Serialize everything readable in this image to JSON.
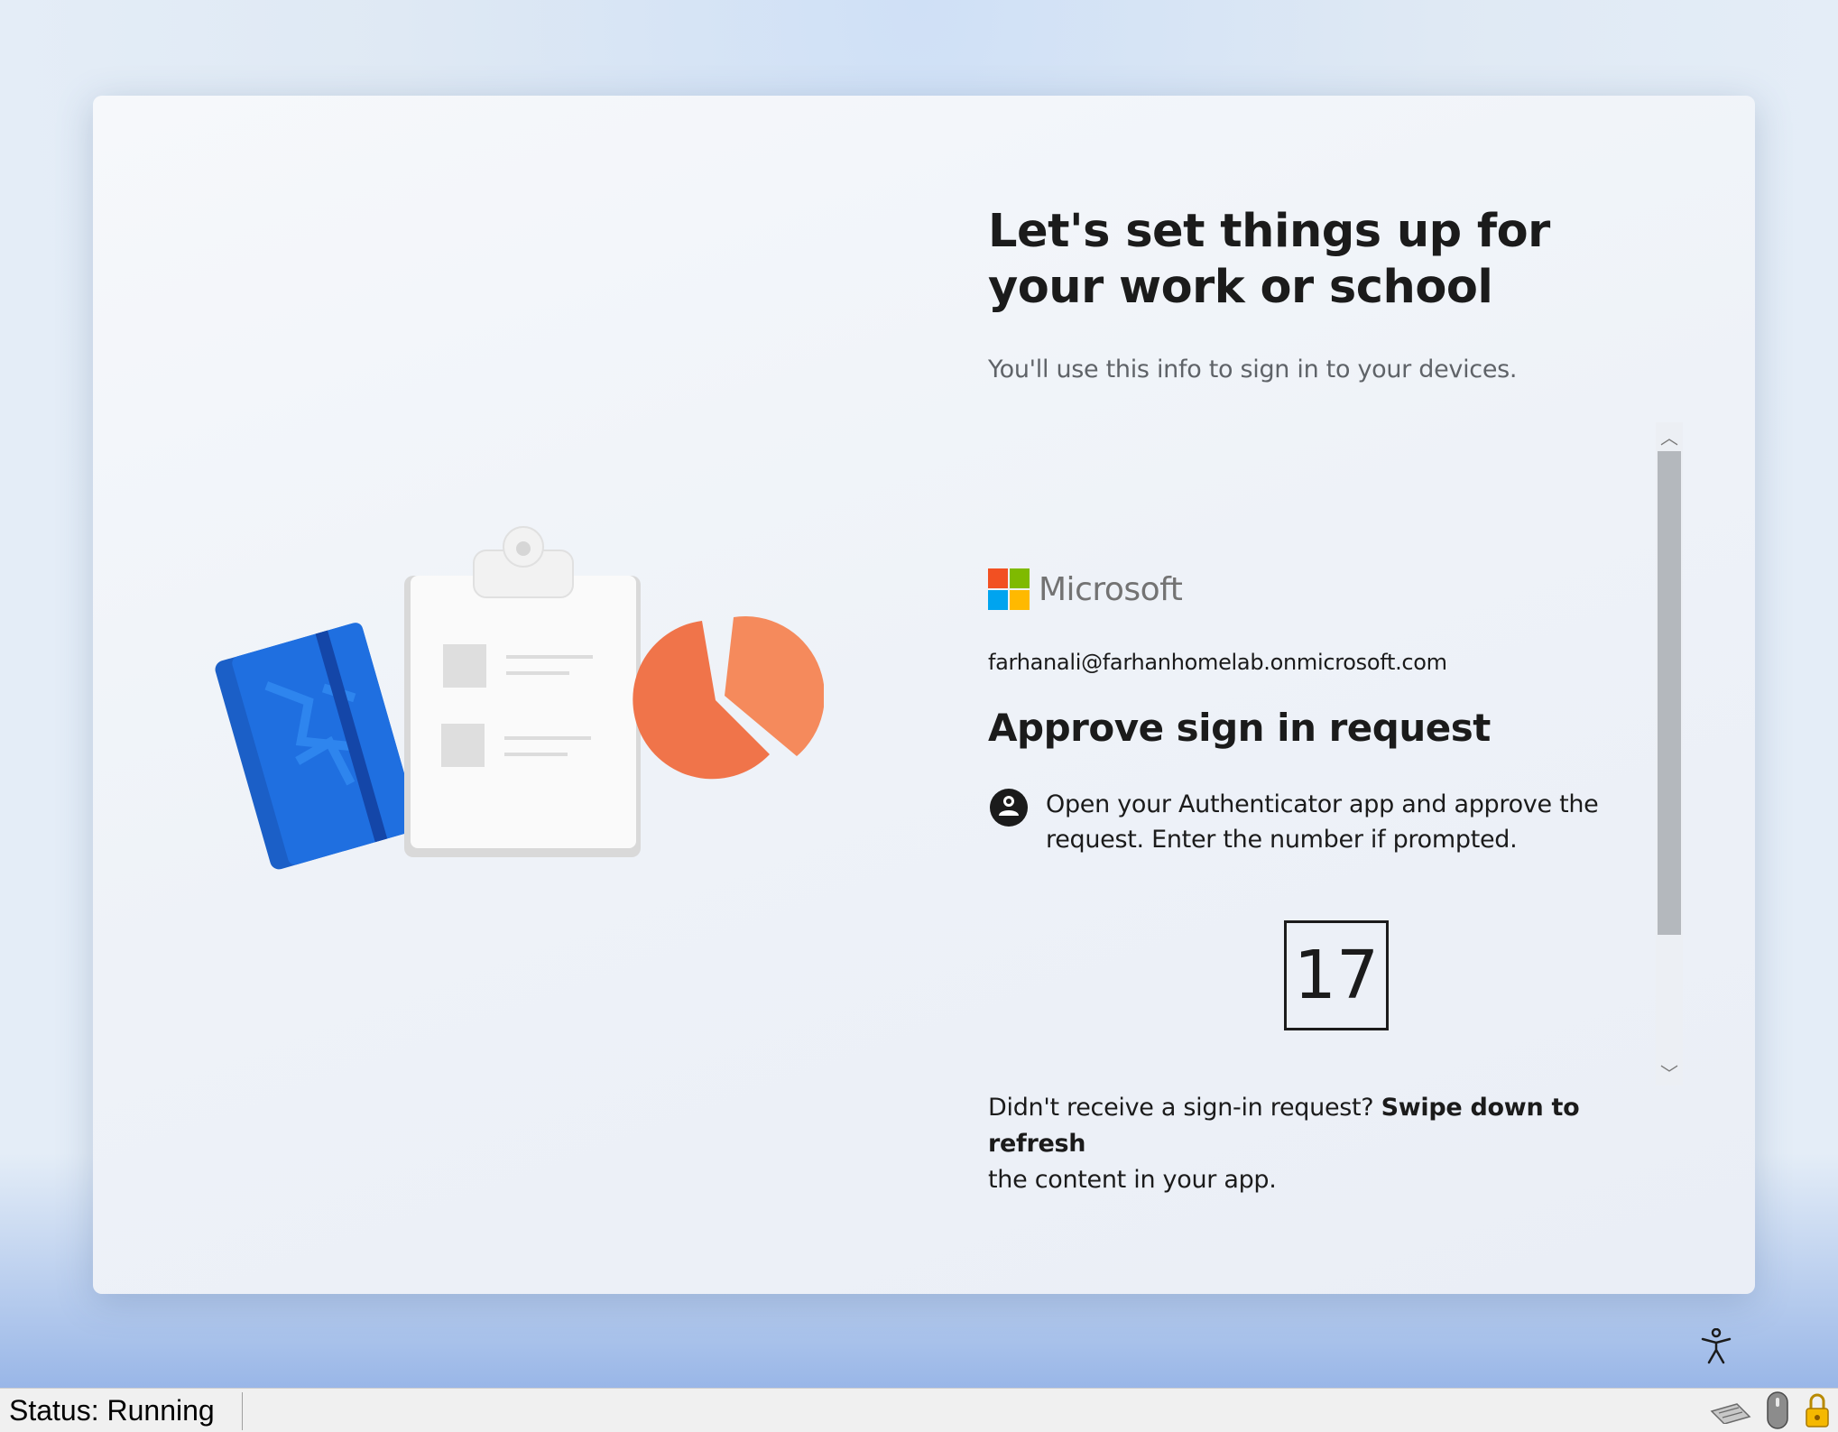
{
  "oobe": {
    "title": "Let's set things up for your work or school",
    "subtitle": "You'll use this info to sign in to your devices."
  },
  "signin": {
    "brand": "Microsoft",
    "brand_colors": [
      "#f25022",
      "#7fba00",
      "#00a4ef",
      "#ffb900"
    ],
    "account_email": "farhanali@farhanhomelab.onmicrosoft.com",
    "approve_title": "Approve sign in request",
    "instruction": "Open your Authenticator app and approve the request. Enter the number if prompted.",
    "auth_icon": "authenticator-lock-icon",
    "number": "17",
    "refresh_prefix": "Didn't receive a sign-in request?",
    "refresh_bold": "Swipe down to refresh",
    "refresh_suffix": "the content in your app."
  },
  "scrollbar": {
    "up_glyph": "︿",
    "down_glyph": "﹀"
  },
  "accessibility": {
    "icon": "accessibility-icon"
  },
  "statusbar": {
    "status": "Status: Running",
    "icons": [
      "keyboard-icon",
      "mouse-icon",
      "lock-icon"
    ]
  }
}
